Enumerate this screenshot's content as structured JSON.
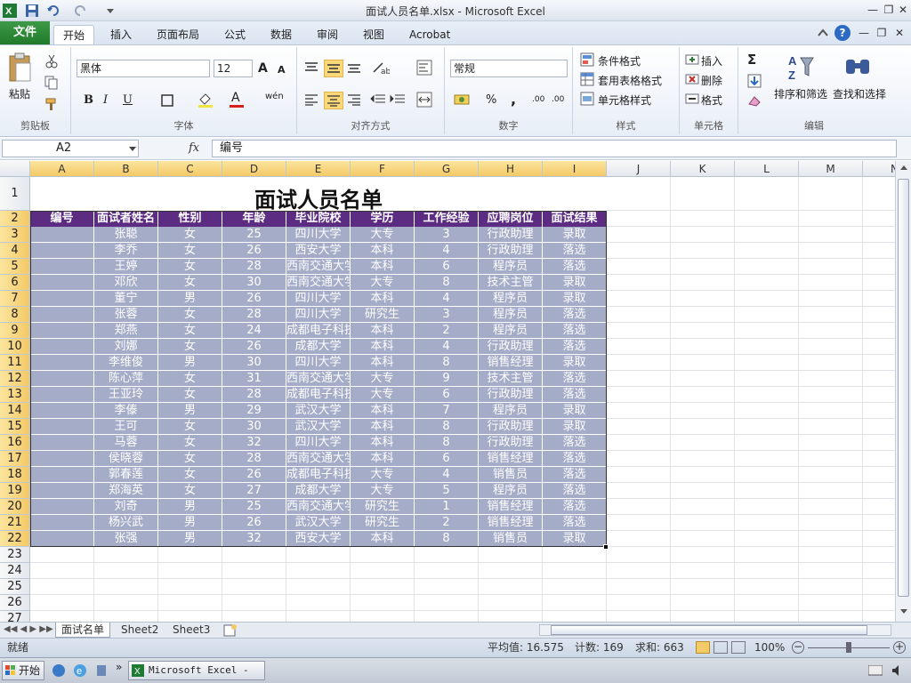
{
  "window": {
    "title": "面试人员名单.xlsx - Microsoft Excel"
  },
  "tabs": {
    "file": "文件",
    "home": "开始",
    "insert": "插入",
    "layout": "页面布局",
    "formulas": "公式",
    "data": "数据",
    "review": "审阅",
    "view": "视图",
    "acrobat": "Acrobat"
  },
  "ribbon": {
    "clipboard": {
      "label": "剪贴板",
      "paste": "粘贴"
    },
    "font": {
      "label": "字体",
      "name": "黑体",
      "size": "12",
      "bold": "B",
      "italic": "I",
      "underline": "U",
      "grow": "A",
      "shrink": "A",
      "color": "A",
      "wen": "wén"
    },
    "alignment": {
      "label": "对齐方式"
    },
    "number": {
      "label": "数字",
      "format": "常规",
      "percent": "%",
      "comma": ",",
      "inc_decimal": ".00",
      "dec_decimal": ".00"
    },
    "styles": {
      "label": "样式",
      "conditional": "条件格式",
      "table": "套用表格格式",
      "cell_styles": "单元格样式"
    },
    "cells": {
      "label": "单元格",
      "insert": "插入",
      "delete": "删除",
      "format": "格式"
    },
    "editing": {
      "label": "编辑",
      "sort": "排序和筛选",
      "find": "查找和选择",
      "sigma": "Σ"
    }
  },
  "formula_bar": {
    "name_box": "A2",
    "fx": "fx",
    "content": "编号"
  },
  "columns": [
    "A",
    "B",
    "C",
    "D",
    "E",
    "F",
    "G",
    "H",
    "I",
    "J",
    "K",
    "L",
    "M",
    "N"
  ],
  "sheet": {
    "title": "面试人员名单",
    "headers": [
      "编号",
      "面试者姓名",
      "性别",
      "年龄",
      "毕业院校",
      "学历",
      "工作经验",
      "应聘岗位",
      "面试结果"
    ],
    "rows": [
      [
        "",
        "张聪",
        "女",
        "25",
        "四川大学",
        "大专",
        "3",
        "行政助理",
        "录取"
      ],
      [
        "",
        "李乔",
        "女",
        "26",
        "西安大学",
        "本科",
        "4",
        "行政助理",
        "落选"
      ],
      [
        "",
        "王婷",
        "女",
        "28",
        "西南交通大学",
        "本科",
        "6",
        "程序员",
        "落选"
      ],
      [
        "",
        "邓欣",
        "女",
        "30",
        "西南交通大学",
        "大专",
        "8",
        "技术主管",
        "录取"
      ],
      [
        "",
        "董宁",
        "男",
        "26",
        "四川大学",
        "本科",
        "4",
        "程序员",
        "录取"
      ],
      [
        "",
        "张蓉",
        "女",
        "28",
        "四川大学",
        "研究生",
        "3",
        "程序员",
        "落选"
      ],
      [
        "",
        "郑燕",
        "女",
        "24",
        "成都电子科技",
        "本科",
        "2",
        "程序员",
        "落选"
      ],
      [
        "",
        "刘娜",
        "女",
        "26",
        "成都大学",
        "本科",
        "4",
        "行政助理",
        "落选"
      ],
      [
        "",
        "李维俊",
        "男",
        "30",
        "四川大学",
        "本科",
        "8",
        "销售经理",
        "录取"
      ],
      [
        "",
        "陈心萍",
        "女",
        "31",
        "西南交通大学",
        "大专",
        "9",
        "技术主管",
        "落选"
      ],
      [
        "",
        "王亚玲",
        "女",
        "28",
        "成都电子科技",
        "大专",
        "6",
        "行政助理",
        "落选"
      ],
      [
        "",
        "李傣",
        "男",
        "29",
        "武汉大学",
        "本科",
        "7",
        "程序员",
        "录取"
      ],
      [
        "",
        "王可",
        "女",
        "30",
        "武汉大学",
        "本科",
        "8",
        "行政助理",
        "录取"
      ],
      [
        "",
        "马蓉",
        "女",
        "32",
        "四川大学",
        "本科",
        "8",
        "行政助理",
        "落选"
      ],
      [
        "",
        "侯晓蓉",
        "女",
        "28",
        "西南交通大学",
        "本科",
        "6",
        "销售经理",
        "落选"
      ],
      [
        "",
        "郭春莲",
        "女",
        "26",
        "成都电子科技",
        "大专",
        "4",
        "销售员",
        "落选"
      ],
      [
        "",
        "郑海英",
        "女",
        "27",
        "成都大学",
        "大专",
        "5",
        "程序员",
        "落选"
      ],
      [
        "",
        "刘奇",
        "男",
        "25",
        "西南交通大学",
        "研究生",
        "1",
        "销售经理",
        "落选"
      ],
      [
        "",
        "杨兴武",
        "男",
        "26",
        "武汉大学",
        "研究生",
        "2",
        "销售经理",
        "落选"
      ],
      [
        "",
        "张强",
        "男",
        "32",
        "西安大学",
        "本科",
        "8",
        "销售员",
        "录取"
      ]
    ]
  },
  "row_numbers": [
    "1",
    "2",
    "3",
    "4",
    "5",
    "6",
    "7",
    "8",
    "9",
    "10",
    "11",
    "12",
    "13",
    "14",
    "15",
    "16",
    "17",
    "18",
    "19",
    "20",
    "21",
    "22",
    "23",
    "24",
    "25",
    "26",
    "27"
  ],
  "sheet_tabs": [
    "面试名单",
    "Sheet2",
    "Sheet3"
  ],
  "status": {
    "ready": "就绪",
    "average": "平均值: 16.575",
    "count": "计数: 169",
    "sum": "求和: 663",
    "zoom": "100%"
  },
  "taskbar": {
    "start": "开始",
    "excel": "Microsoft Excel - ..."
  },
  "colors": {
    "header_bg": "#5b2c82",
    "cell_bg": "#a4acc8",
    "file_tab": "#2e8b3a",
    "selection": "#f4c967"
  }
}
